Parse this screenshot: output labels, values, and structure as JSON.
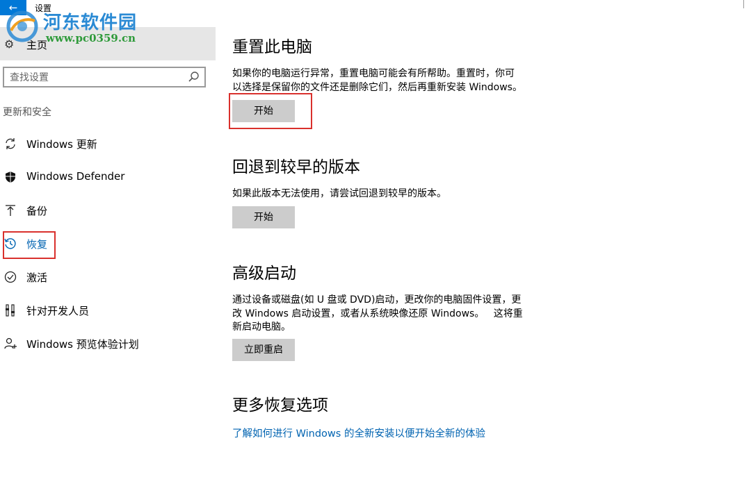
{
  "window": {
    "title": "设置",
    "back_icon": "back-arrow-icon",
    "accent_color": "#0078d7"
  },
  "watermark": {
    "name": "河东软件园",
    "url": "www.pc0359.cn"
  },
  "sidebar": {
    "home": {
      "label": "主页",
      "icon": "gear-icon"
    },
    "search": {
      "placeholder": "查找设置",
      "icon": "search-icon"
    },
    "section": "更新和安全",
    "items": [
      {
        "label": "Windows 更新",
        "icon": "refresh-icon",
        "active": false
      },
      {
        "label": "Windows Defender",
        "icon": "shield-icon",
        "active": false
      },
      {
        "label": "备份",
        "icon": "upload-icon",
        "active": false
      },
      {
        "label": "恢复",
        "icon": "history-icon",
        "active": true
      },
      {
        "label": "激活",
        "icon": "check-circle-icon",
        "active": false
      },
      {
        "label": "针对开发人员",
        "icon": "developer-tools-icon",
        "active": false
      },
      {
        "label": "Windows 预览体验计划",
        "icon": "insider-user-icon",
        "active": false
      }
    ]
  },
  "main": {
    "reset": {
      "title": "重置此电脑",
      "desc_line1": "如果你的电脑运行异常，重置电脑可能会有所帮助。重置时，你可",
      "desc_line2": "以选择是保留你的文件还是删除它们，然后再重新安装 Windows。",
      "button": "开始"
    },
    "rollback": {
      "title": "回退到较早的版本",
      "desc": "如果此版本无法使用，请尝试回退到较早的版本。",
      "button": "开始"
    },
    "advanced": {
      "title": "高级启动",
      "desc_line1": "通过设备或磁盘(如 U 盘或 DVD)启动，更改你的电脑固件设置，更",
      "desc_line2": "改 Windows 启动设置，或者从系统映像还原 Windows。   这将重",
      "desc_line3": "新启动电脑。",
      "button": "立即重启"
    },
    "more": {
      "title": "更多恢复选项",
      "link": "了解如何进行 Windows 的全新安装以便开始全新的体验"
    }
  },
  "colors": {
    "highlight_border": "#d9302c",
    "link": "#0063b1",
    "button_bg": "#cccccc"
  }
}
